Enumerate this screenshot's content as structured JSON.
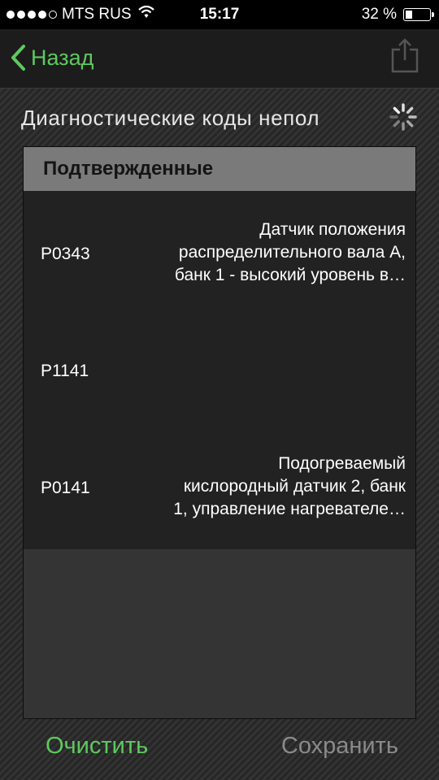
{
  "status_bar": {
    "carrier": "MTS RUS",
    "time": "15:17",
    "battery": "32 %",
    "battery_level": 0.32,
    "signal_bars": 4
  },
  "nav": {
    "back_label": "Назад",
    "back_icon": "chevron-left-icon",
    "share_icon": "share-icon"
  },
  "section": {
    "title": "Диагностические коды непол"
  },
  "panel": {
    "header": "Подтвержденные",
    "rows": [
      {
        "code": "P0343",
        "description": "Датчик положения\nраспределительного вала А,\nбанк 1 - высокий уровень в…"
      },
      {
        "code": "P1141",
        "description": ""
      },
      {
        "code": "P0141",
        "description": "Подогреваемый\nкислородный датчик 2, банк\n1, управление нагревателе…"
      }
    ]
  },
  "toolbar": {
    "clear_label": "Очистить",
    "save_label": "Сохранить"
  },
  "colors": {
    "accent": "#5ec95e",
    "disabled": "#8a8a8a"
  }
}
